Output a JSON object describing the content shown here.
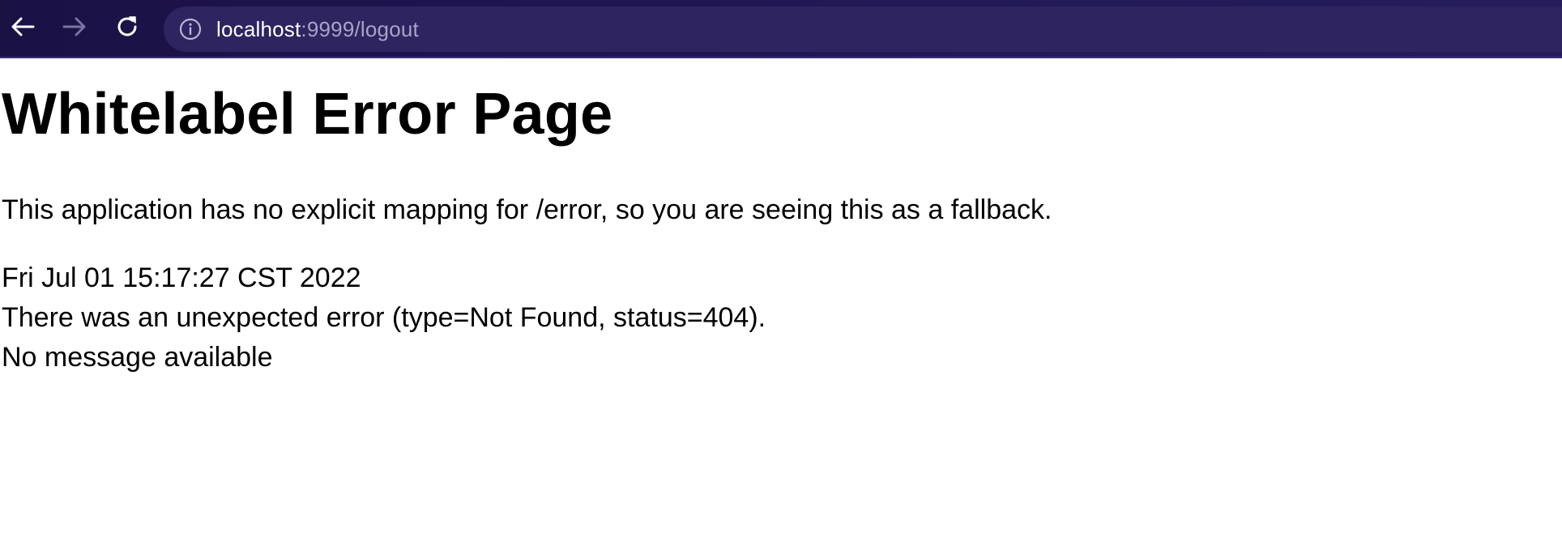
{
  "browser": {
    "url_host": "localhost",
    "url_rest": ":9999/logout",
    "icons": {
      "back": "back-arrow-icon",
      "forward": "forward-arrow-icon",
      "reload": "reload-icon",
      "info": "info-icon"
    },
    "colors": {
      "toolbar_bg": "#1f1550",
      "address_bg": "#2d2460",
      "host_text": "#ffffff",
      "rest_text": "#a9a4c6"
    }
  },
  "page": {
    "title": "Whitelabel Error Page",
    "mapping_text": "This application has no explicit mapping for /error, so you are seeing this as a fallback.",
    "timestamp": "Fri Jul 01 15:17:27 CST 2022",
    "error_text": "There was an unexpected error (type=Not Found, status=404).",
    "message_text": "No message available"
  }
}
